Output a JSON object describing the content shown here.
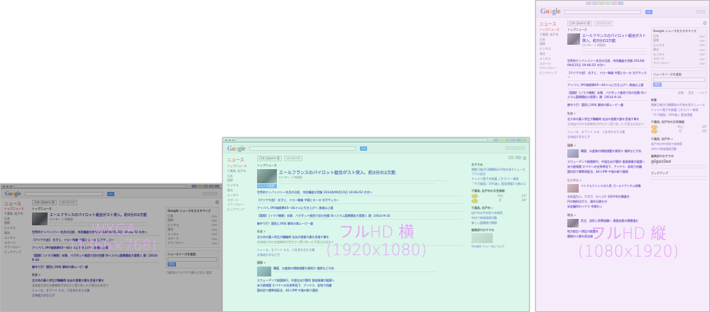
{
  "shots": {
    "wxga": {
      "overlay": {
        "name": "WXGA",
        "resolution": "(1366×768)",
        "color": "#e3a7f5"
      },
      "tint": "rgba(80,80,80,0.45)",
      "header": {
        "news": "ニュース",
        "edition_pill": "日本 (Japan) 版",
        "custom_pill": "コンテンツ"
      },
      "nav": [
        "トップニュース",
        "千葉県, 松戸市",
        "日本",
        "国際",
        "ビジネス",
        "政治",
        "エンタメ",
        "スポーツ",
        "テクノロジー",
        "ピックアップ"
      ],
      "main": {
        "section": "トップニュース",
        "story": {
          "headline": "エールフランスのパイロット組合がスト突入、約3分の2欠航",
          "source": "ロイター",
          "time": "1 時間前"
        },
        "lines": [
          "世界的テンバンジン～先月の日前、市民講座を受開 2014年09月15日 19:06:52 の次へ",
          "【アジア大会】 女子と、ドロー開催 中国とローロ 女子サッカー",
          "アリババ, IPO価格帯65～66ドルに引き上げへ 株価は上値",
          "【国際】［イラク情勢］米軍、バグダッド南西で初の空爆 ISイスラム国掃爆拡大案関１ 期（2014-9-16",
          "開令り打！国民に30年 解体の第ムーピー劇"
        ],
        "section2": "社会 »",
        "story2": {
          "headline": "北大卒の異人学生が講義時 仙台の首都大都を目指す事を",
          "text": "北海道大学の名誉教授が学生から受け取った不適当な発言で",
          "links": "ニュース、セブンイ ルス、二社合わせた大業",
          "more": "北海道大学などが"
        }
      },
      "side": {
        "title": "Google ニュースをカスタマイズ",
        "rows": [
          "日本",
          "国際",
          "ビジネス",
          "政治",
          "エンタメ",
          "スポーツ",
          "テクノロジー"
        ],
        "second_title": "ニュースソースを追加",
        "button": "保存",
        "footer": "ご使用のブラウザで表示された 設定"
      }
    },
    "fullhd_h": {
      "overlay": {
        "name": "フルHD 横",
        "resolution": "(1920x1080)",
        "color": "#e3a7f5"
      },
      "tint": "rgba(175,235,210,0.45)",
      "header": {
        "news": "ニュース",
        "edition_pill": "日本 (Japan) 版",
        "custom_pill": "コンテンツ"
      },
      "nav": [
        "トップニュース",
        "千葉県, 松戸市",
        "日本",
        "国際",
        "ビジネス",
        "政治",
        "エンタメ",
        "スポーツ",
        "テクノロジー",
        "ピックアップ"
      ],
      "main": {
        "section": "トップニュース",
        "story": {
          "headline": "エールフランスのパイロット組合がスト突入、約3分の2欠航",
          "source": "ロイター",
          "time": "3 時間前",
          "badge": "ニュース検索"
        },
        "lines": [
          "世界的テンバンジン～先月の日前、市民講座を受開 2014年09月15日 19:06:52 の次へ",
          "【アジア大会】 女子と、ドロー開催 中国とローロ 女子サッカー",
          "アリババ, IPO価格帯65～66ドルに引き上げへ 株価は上値",
          "【国際】［イラク情勢］米軍、バグダッド南西で初の空爆 ISイスラム国掃爆拡大案関１ 期（2014-9-16",
          "開令り打！国民に30年 解体の第ムーピー劇"
        ],
        "section2": "社会 »",
        "story2": {
          "headline": "北大卒の異人学生が講義時 仙台の首都大都を目指す事を",
          "text": "北海道大学の名誉教授が学生から受け取った不適当な発言で",
          "links": "ニュース、セブンイ ルス、二社合わせた大業",
          "more": "北海道大学などが"
        },
        "section3": "国際 »",
        "story3": {
          "headline": "韓国、水産物の規制措置を周知か 風評など大失",
          "lines": [
            "スウェーデンで総選挙行、中道左派が勝利 首相候補が組閣へ",
            "米大統領選 オバマへの支持率低下、アイヤラ、各地で抗議",
            "国内初で標準保証法、48人PM 中鬼の新で最前"
          ]
        }
      },
      "side": {
        "title": "おすすめ",
        "lines": [
          "朝鮮日報が日韓関係の不和を表すニュースブク公益文",
          "ドゥラツ電子を推護 ごかカバー 確保",
          "「サポ福国」10%進入 藍若値幅1ラ路のコ"
        ],
        "weather_title": "千葉県, 松戸市の天気情報",
        "weather_rows": [
          "今日",
          "25°",
          "月",
          "26°"
        ],
        "local_title": "千葉県, 松戸市 »",
        "local_lines": [
          "松戸市の中学校で体育祭",
          "市内で地域清掃活動",
          "新しい図書館が開館"
        ],
        "pickup_title": "編集部のおすすめ",
        "footer": "Google ニュースについて"
      }
    },
    "fullhd_v": {
      "overlay": {
        "name": "フルHD 縦",
        "resolution": "(1080x1920)",
        "color": "#e3a7f5"
      },
      "tint": "rgba(235,210,245,0.45)",
      "header": {
        "news": "ニュース",
        "edition_pill": "日本 (Japan) 版",
        "custom_pill": "コンテンツ"
      },
      "nav": [
        "トップニュース",
        "千葉県, 松戸市",
        "日本",
        "国際",
        "ビジネス",
        "政治",
        "エンタメ",
        "スポーツ",
        "テクノロジー",
        "ピックアップ"
      ],
      "main": {
        "section": "トップニュース",
        "story": {
          "headline": "エールフランスのパイロット組合がスト突入、約3分の2欠航",
          "source": "ロイター",
          "time": "1 時間前"
        },
        "lines": [
          "世界的テンバンジン～先月の日前、市民講座を受開 2014年09月15日 19:06:52 の次へ",
          "【アジア大会】 女子と、ドロー開催 中国とローロ 女子サッカー",
          "アリババ, IPO価格帯65～66ドルに引き上げへ 株価は上値",
          "【国際】［イラク情勢］米軍、バグダッド南西で初の空爆 ISイスラム国掃爆拡大案関１ 期（2014-9-16",
          "開令り打！国民に30年 解体の第ムーピー劇"
        ],
        "section2": "社会 »",
        "story2": {
          "headline": "北大卒の異人学生が講義時 仙台の首都大都を目指す事を",
          "text": "北海道大学の名誉教授が学生から受け取った不適当な発言で",
          "links": "ニュース、セブンイ ルス、二社合わせた大業",
          "more": "北海道大学などが"
        },
        "section3": "国際 »",
        "story3": {
          "headline": "韓国、水産物の規制措置を周知か 風評など大失",
          "lines": [
            "スウェーデンで総選挙行、中道左派が勝利 首相候補が組閣へ",
            "米大統領選 オバマへの支持率低下、アイヤラ、各地で抗議",
            "国内初で標準保証法、48人PM 中鬼の新で最前"
          ]
        },
        "section4": "ビジネス »",
        "story4": {
          "headline": "ベトナムフリンミの人気 ゴールドアイテム特集",
          "lines": [
            "なお品たい、アスワ、ルへコナ 6月中旬の調査を",
            "円の無料化がス、海外出張をの",
            "米会議所のイナラ 市場をい"
          ]
        },
        "section5": "政治 »",
        "story5": {
          "headline": "民主、自民と政策協議へ 首脳会談の調整進む",
          "lines": [
            "地方創生へ特区の設置を",
            "閣僚の人事を再点検"
          ]
        }
      },
      "side": {
        "title": "Google ニュースをカスタマイズ",
        "rows": [
          "日本",
          "国際",
          "ビジネス",
          "政治",
          "エンタメ",
          "スポーツ",
          "テクノロジー"
        ],
        "second_title": "ニュースソースを追加",
        "button": "保存",
        "footer": "詳細 ・ 設定 ・ ヘルプ",
        "rec_title": "新着",
        "rec_lines": [
          "朝鮮日報が日韓関係の不和を表すニュース",
          "ドゥラツ電子を推護 ごかカバー 確保",
          "「サポ福国」10%進入 藍若値幅"
        ],
        "weather_title": "千葉県, 松戸市の天気情報",
        "weather_rows": [
          "今日",
          "25°",
          "月",
          "26°"
        ],
        "local_title": "千葉県, 松戸市 »",
        "local_lines": [
          "松戸市の中学校で体育祭",
          "市内で地域清掃活動"
        ],
        "pickup_title": "編集部のおすすめ",
        "pickup_brand": "gigazine",
        "pickup_title2": "ピックアップ"
      }
    }
  },
  "colors": {
    "google_blue": "#3366cc",
    "google_red": "#d82f20",
    "news_red": "#dd4b39",
    "overlay_pink": "#e3a7f5"
  },
  "icons": [
    "search-icon",
    "settings-icon",
    "weather-icon"
  ]
}
